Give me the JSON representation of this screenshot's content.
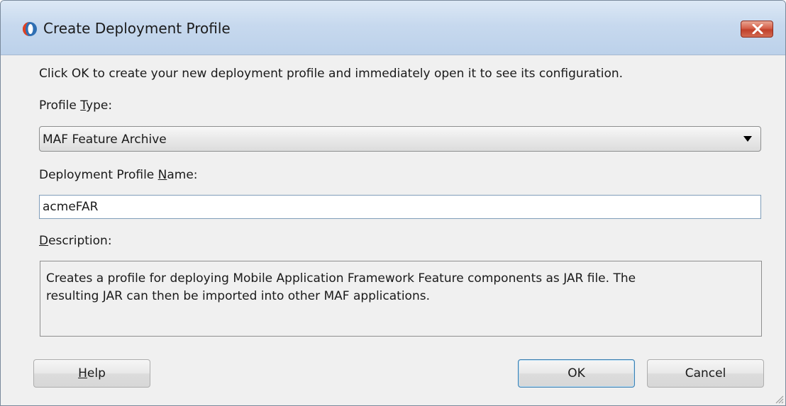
{
  "window": {
    "title": "Create Deployment Profile",
    "app_icon": "oracle-jdeveloper-icon",
    "close_icon": "close-icon"
  },
  "instructions": "Click OK to create your new deployment profile and immediately open it to see its configuration.",
  "profile_type": {
    "label_before": "Profile ",
    "label_mnemonic": "T",
    "label_after": "ype:",
    "selected": "MAF Feature Archive"
  },
  "profile_name": {
    "label_before": "Deployment Profile ",
    "label_mnemonic": "N",
    "label_after": "ame:",
    "value": "acmeFAR"
  },
  "description": {
    "label_before": "",
    "label_mnemonic": "D",
    "label_after": "escription:",
    "line1": "Creates a profile for deploying Mobile Application Framework Feature components as JAR file.  The",
    "line2": "resulting JAR can then be imported into other MAF applications."
  },
  "buttons": {
    "help_mnemonic": "H",
    "help_rest": "elp",
    "ok": "OK",
    "cancel": "Cancel"
  },
  "colors": {
    "titlebar": "#c7d9ee",
    "close_button": "#c0402a",
    "dialog_bg": "#f0f0f0",
    "ok_focus_border": "#3c7fb1"
  }
}
